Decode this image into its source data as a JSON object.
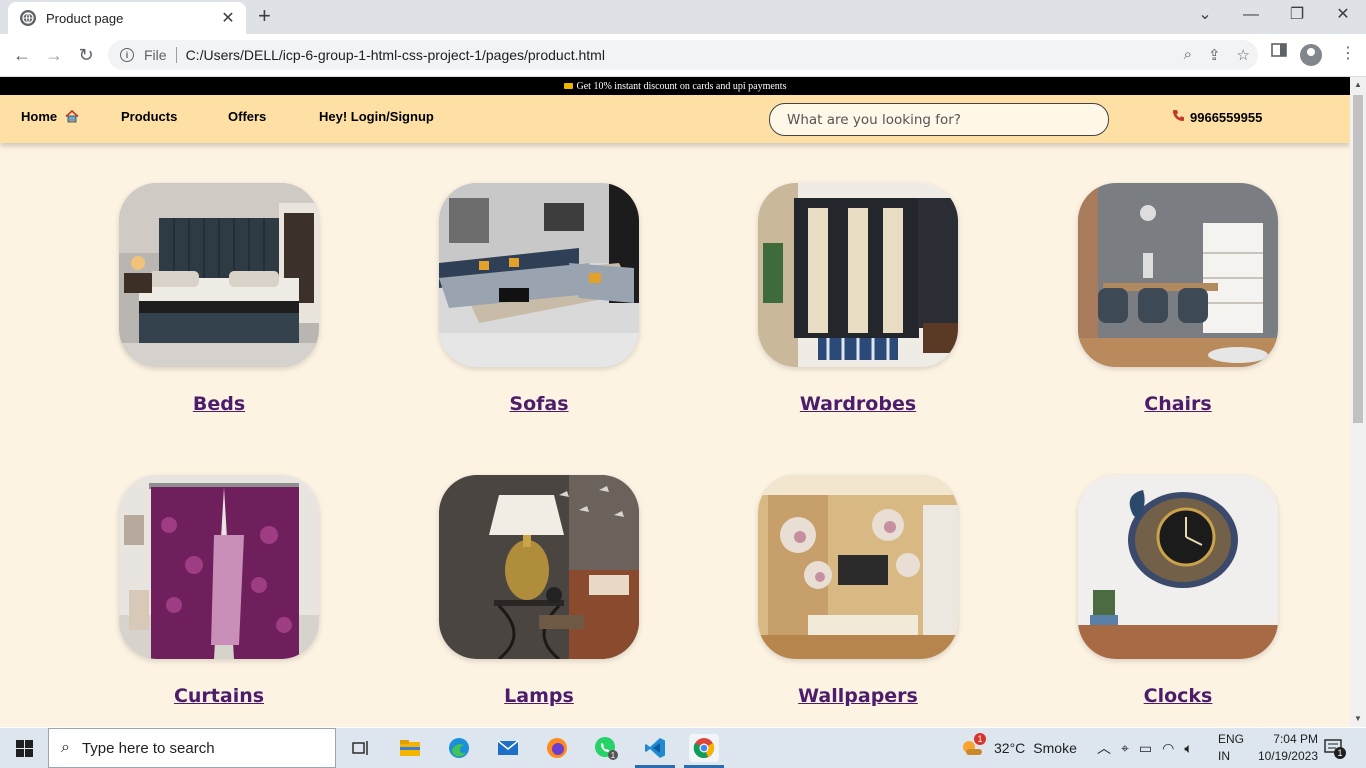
{
  "browser": {
    "tab_title": "Product page",
    "url_scheme_label": "File",
    "url": "C:/Users/DELL/icp-6-group-1-html-css-project-1/pages/product.html"
  },
  "promo": {
    "text": "Get 10% instant discount on cards and upi payments"
  },
  "nav": {
    "home": "Home",
    "products": "Products",
    "offers": "Offers",
    "login": "Hey! Login/Signup",
    "search_placeholder": "What are you looking for?",
    "phone": "9966559955"
  },
  "categories": [
    {
      "label": "Beds"
    },
    {
      "label": "Sofas"
    },
    {
      "label": "Wardrobes"
    },
    {
      "label": "Chairs"
    },
    {
      "label": "Curtains"
    },
    {
      "label": "Lamps"
    },
    {
      "label": "Wallpapers"
    },
    {
      "label": "Clocks"
    }
  ],
  "colors": {
    "page_bg": "#fdf3e3",
    "nav_bg": "#fee0a5",
    "link": "#4b1d6b",
    "promo_bg": "#000000"
  },
  "taskbar": {
    "search_placeholder": "Type here to search",
    "weather_temp": "32°C",
    "weather_text": "Smoke",
    "lang_top": "ENG",
    "lang_bottom": "IN",
    "time": "7:04 PM",
    "date": "10/19/2023",
    "weather_badge": "1",
    "whatsapp_badge": "1",
    "notification_badge": "1"
  }
}
